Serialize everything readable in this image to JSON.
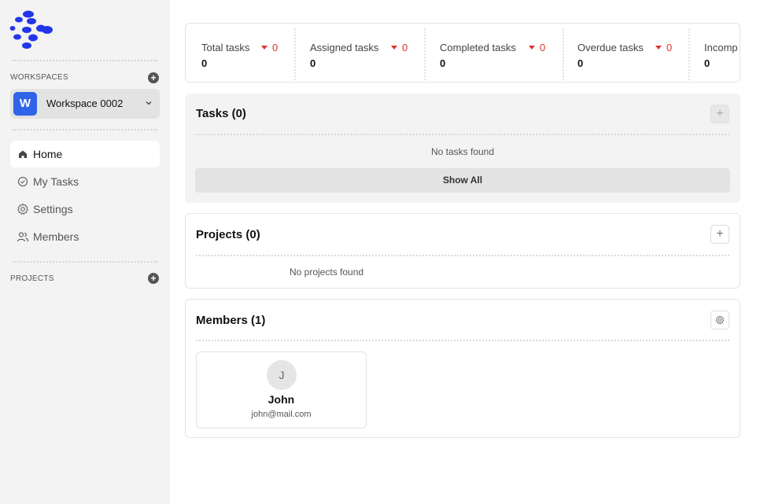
{
  "sidebar": {
    "workspaces_label": "WORKSPACES",
    "workspace": {
      "initial": "W",
      "name": "Workspace 0002"
    },
    "nav": [
      {
        "label": "Home",
        "icon": "home-icon"
      },
      {
        "label": "My Tasks",
        "icon": "check-circle-icon"
      },
      {
        "label": "Settings",
        "icon": "gear-icon"
      },
      {
        "label": "Members",
        "icon": "users-icon"
      }
    ],
    "projects_label": "PROJECTS"
  },
  "stats": [
    {
      "label": "Total tasks",
      "delta": "0",
      "value": "0"
    },
    {
      "label": "Assigned tasks",
      "delta": "0",
      "value": "0"
    },
    {
      "label": "Completed tasks",
      "delta": "0",
      "value": "0"
    },
    {
      "label": "Overdue tasks",
      "delta": "0",
      "value": "0"
    },
    {
      "label": "Incomp",
      "value": "0"
    }
  ],
  "tasks": {
    "title": "Tasks (0)",
    "empty": "No tasks found",
    "show_all": "Show All"
  },
  "projects": {
    "title": "Projects (0)",
    "empty": "No projects found"
  },
  "members": {
    "title": "Members (1)",
    "list": [
      {
        "initial": "J",
        "name": "John",
        "email": "john@mail.com"
      }
    ]
  },
  "colors": {
    "accent": "#2f63e8",
    "negative": "#e0322d",
    "logo": "#2336e8"
  }
}
